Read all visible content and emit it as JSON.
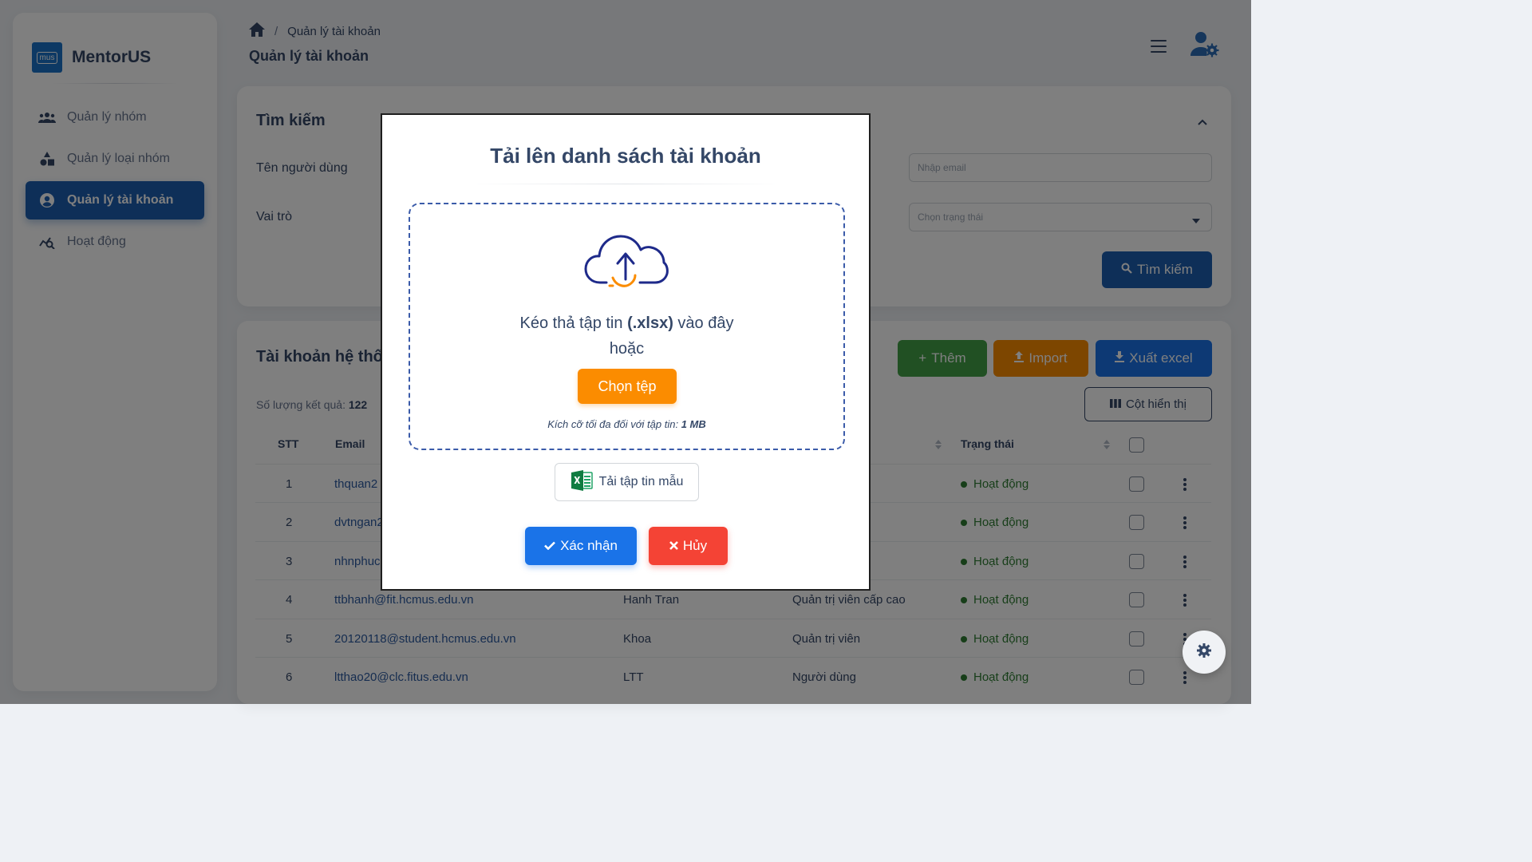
{
  "app": {
    "name": "MentorUS",
    "logo_text": "mus"
  },
  "sidebar": {
    "items": [
      {
        "label": "Quản lý nhóm",
        "icon": "group-icon",
        "active": false
      },
      {
        "label": "Quản lý loại nhóm",
        "icon": "shapes-icon",
        "active": false
      },
      {
        "label": "Quản lý tài khoản",
        "icon": "account-circle-icon",
        "active": true
      },
      {
        "label": "Hoạt động",
        "icon": "analytics-icon",
        "active": false
      }
    ]
  },
  "header": {
    "breadcrumb_current": "Quản lý tài khoản",
    "breadcrumb_sep": "/",
    "title": "Quản lý tài khoản"
  },
  "search": {
    "title": "Tìm kiếm",
    "name_label": "Tên người dùng",
    "role_label": "Vai trò",
    "email_placeholder": "Nhập email",
    "status_placeholder": "Chọn trạng thái",
    "search_button": "Tìm kiếm"
  },
  "accounts": {
    "title": "Tài khoản hệ thống",
    "count_label": "Số lượng kết quả:",
    "count_value": "122",
    "add_button": "Thêm",
    "import_button": "Import",
    "export_button": "Xuất excel",
    "columns_button": "Cột hiển thị",
    "headers": {
      "stt": "STT",
      "email": "Email",
      "status": "Trạng thái"
    },
    "rows": [
      {
        "stt": "1",
        "email": "thquan2",
        "name": "",
        "role": "",
        "status": "Hoạt động"
      },
      {
        "stt": "2",
        "email": "dvtngan2",
        "name": "",
        "role": "",
        "status": "Hoạt động"
      },
      {
        "stt": "3",
        "email": "nhnphuc",
        "name": "",
        "role": "",
        "status": "Hoạt động"
      },
      {
        "stt": "4",
        "email": "ttbhanh@fit.hcmus.edu.vn",
        "name": "Hanh Tran",
        "role": "Quản trị viên cấp cao",
        "status": "Hoạt động"
      },
      {
        "stt": "5",
        "email": "20120118@student.hcmus.edu.vn",
        "name": "Khoa",
        "role": "Quản trị viên",
        "status": "Hoạt động"
      },
      {
        "stt": "6",
        "email": "ltthao20@clc.fitus.edu.vn",
        "name": "LTT",
        "role": "Người dùng",
        "status": "Hoạt động"
      }
    ]
  },
  "modal": {
    "title": "Tải lên danh sách tài khoản",
    "drop_text_before": "Kéo thả tập tin ",
    "drop_text_ext": "(.xlsx)",
    "drop_text_after": " vào đây",
    "or_text": "hoặc",
    "choose_button": "Chọn tệp",
    "size_note_prefix": "Kích cỡ tối đa đối với tập tin: ",
    "size_note_value": "1 MB",
    "template_button": "Tải tập tin mẫu",
    "confirm_button": "Xác nhận",
    "cancel_button": "Hủy"
  },
  "colors": {
    "primary": "#1a73e8",
    "sidebar_active": "#1d5fb0",
    "success": "#2e7d32",
    "warning": "#fb8c00",
    "danger": "#f44335",
    "dropzone_border": "#3b5ba9"
  }
}
